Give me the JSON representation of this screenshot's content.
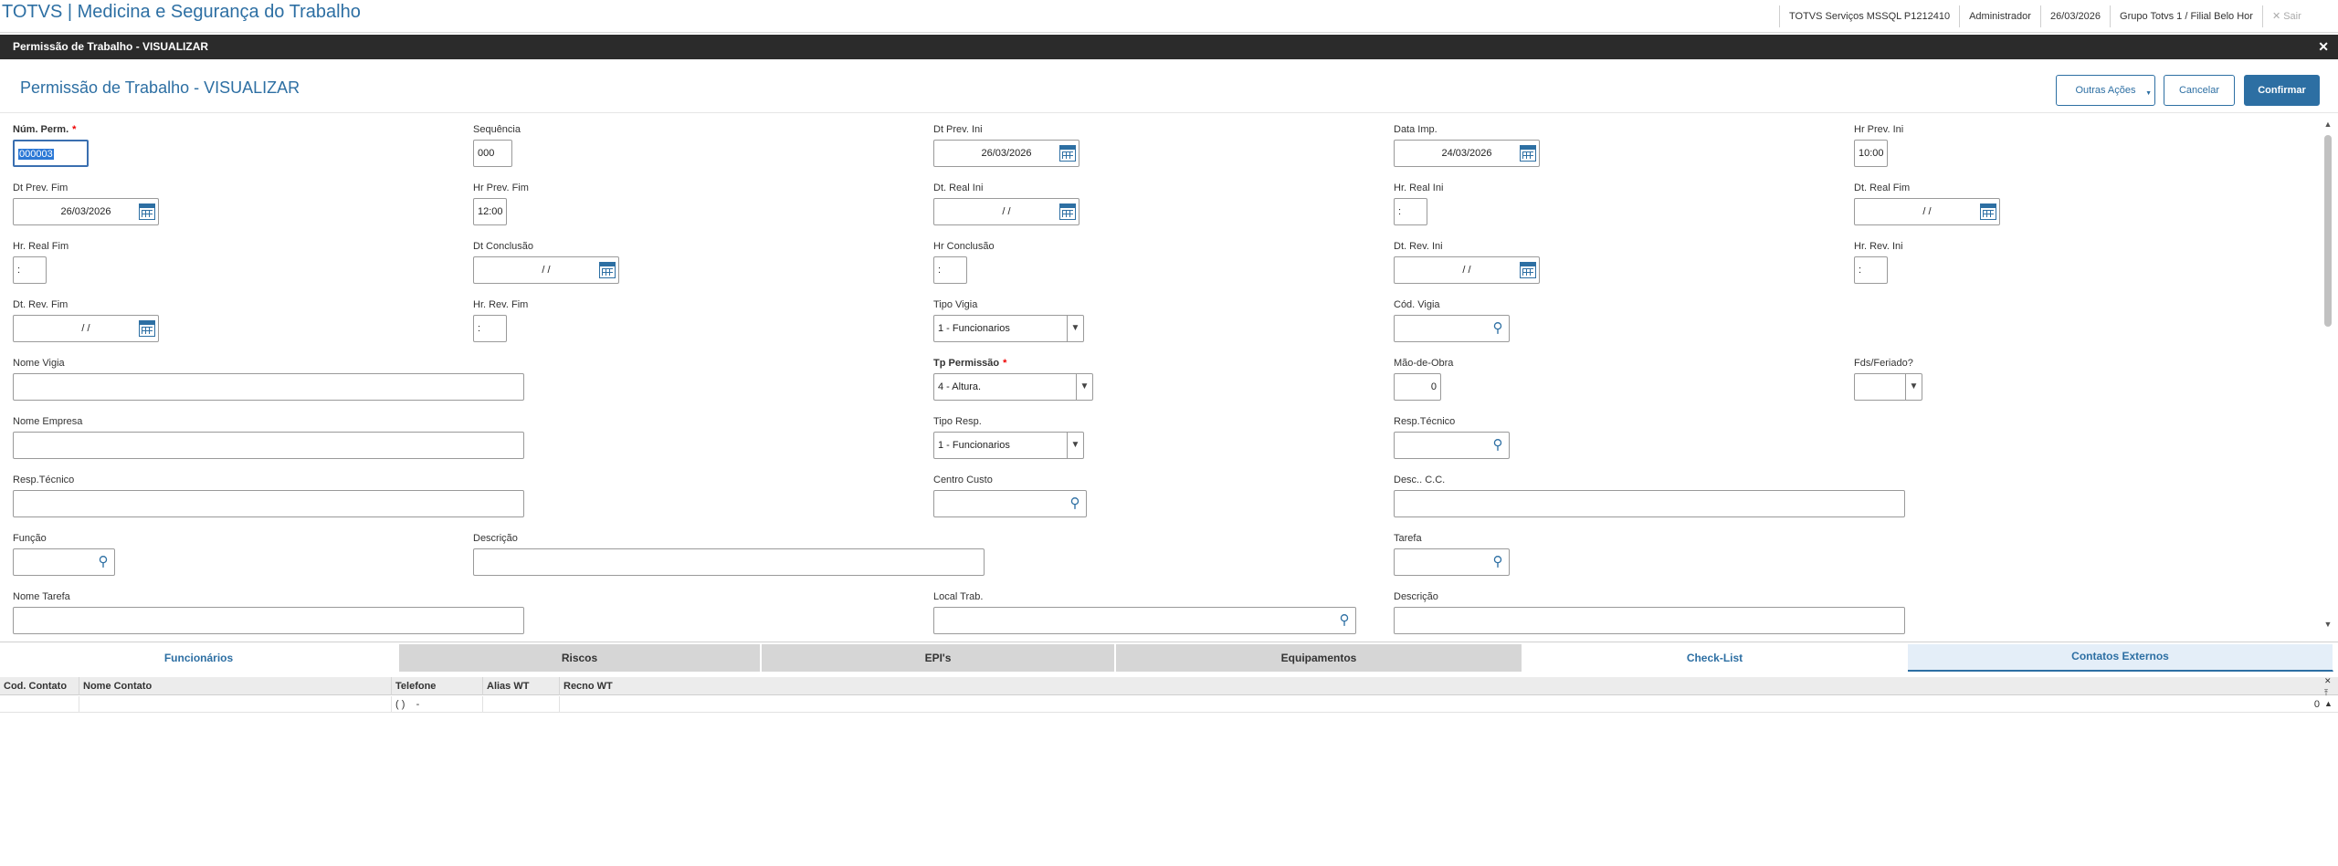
{
  "header": {
    "app_title": "TOTVS | Medicina e Segurança do Trabalho",
    "server": "TOTVS Serviços MSSQL P1212410",
    "user": "Administrador",
    "date": "26/03/2026",
    "branch": "Grupo Totvs 1 / Filial Belo Hor",
    "logout_label": "Sair"
  },
  "dialog": {
    "bar_title": "Permissão de Trabalho - VISUALIZAR",
    "title": "Permissão de Trabalho - VISUALIZAR",
    "buttons": {
      "other_actions": "Outras Ações",
      "cancel": "Cancelar",
      "confirm": "Confirmar"
    }
  },
  "form": {
    "num_perm": {
      "label": "Núm. Perm.",
      "value": "000003"
    },
    "sequencia": {
      "label": "Sequência",
      "value": "000"
    },
    "dt_prev_ini": {
      "label": "Dt Prev. Ini",
      "value": "26/03/2026"
    },
    "data_imp": {
      "label": "Data Imp.",
      "value": "24/03/2026"
    },
    "hr_prev_ini": {
      "label": "Hr Prev. Ini",
      "value": "10:00"
    },
    "dt_prev_fim": {
      "label": "Dt Prev. Fim",
      "value": "26/03/2026"
    },
    "hr_prev_fim": {
      "label": "Hr Prev. Fim",
      "value": "12:00"
    },
    "dt_real_ini": {
      "label": "Dt. Real Ini",
      "value": "/ /"
    },
    "hr_real_ini": {
      "label": "Hr. Real Ini",
      "value": ":"
    },
    "dt_real_fim": {
      "label": "Dt. Real Fim",
      "value": "/ /"
    },
    "hr_real_fim": {
      "label": "Hr. Real Fim",
      "value": ":"
    },
    "dt_conclusao": {
      "label": "Dt Conclusão",
      "value": "/ /"
    },
    "hr_conclusao": {
      "label": "Hr Conclusão",
      "value": ":"
    },
    "dt_rev_ini": {
      "label": "Dt. Rev. Ini",
      "value": "/ /"
    },
    "hr_rev_ini": {
      "label": "Hr. Rev. Ini",
      "value": ":"
    },
    "dt_rev_fim": {
      "label": "Dt. Rev. Fim",
      "value": "/ /"
    },
    "hr_rev_fim": {
      "label": "Hr. Rev. Fim",
      "value": ":"
    },
    "tipo_vigia": {
      "label": "Tipo Vigia",
      "value": "1 - Funcionarios"
    },
    "cod_vigia": {
      "label": "Cód. Vigia",
      "value": ""
    },
    "nome_vigia": {
      "label": "Nome Vigia",
      "value": ""
    },
    "tp_permissao": {
      "label": "Tp Permissão",
      "value": "4 - Altura."
    },
    "mao_de_obra": {
      "label": "Mão-de-Obra",
      "value": "0"
    },
    "fds_feriado": {
      "label": "Fds/Feriado?",
      "value": ""
    },
    "nome_empresa": {
      "label": "Nome Empresa",
      "value": ""
    },
    "tipo_resp": {
      "label": "Tipo Resp.",
      "value": "1 - Funcionarios"
    },
    "resp_tecnico_cod": {
      "label": "Resp.Técnico",
      "value": ""
    },
    "resp_tecnico_nome": {
      "label": "Resp.Técnico",
      "value": ""
    },
    "centro_custo": {
      "label": "Centro Custo",
      "value": ""
    },
    "desc_cc": {
      "label": "Desc.. C.C.",
      "value": ""
    },
    "funcao": {
      "label": "Função",
      "value": ""
    },
    "descricao_funcao": {
      "label": "Descrição",
      "value": ""
    },
    "tarefa": {
      "label": "Tarefa",
      "value": ""
    },
    "nome_tarefa": {
      "label": "Nome Tarefa",
      "value": ""
    },
    "local_trab": {
      "label": "Local Trab.",
      "value": ""
    },
    "descricao_local": {
      "label": "Descrição",
      "value": ""
    }
  },
  "tabs": [
    {
      "label": "Funcionários"
    },
    {
      "label": "Riscos"
    },
    {
      "label": "EPI's"
    },
    {
      "label": "Equipamentos"
    },
    {
      "label": "Check-List"
    },
    {
      "label": "Contatos Externos"
    }
  ],
  "grid": {
    "columns": [
      "Cod. Contato",
      "Nome Contato",
      "Telefone",
      "Alias WT",
      "Recno WT"
    ],
    "rows": [
      {
        "cod": "",
        "nome": "",
        "telefone": "( )    -",
        "alias": "",
        "recno": "",
        "count": "0"
      }
    ]
  },
  "icons": {
    "calendar": "calendar-icon",
    "search": "search-icon",
    "dropdown": "chevron-down-icon",
    "close": "close-icon"
  },
  "colors": {
    "accent": "#2d6fa3",
    "dialog_bar": "#2b2b2b",
    "required": "#e00000"
  }
}
